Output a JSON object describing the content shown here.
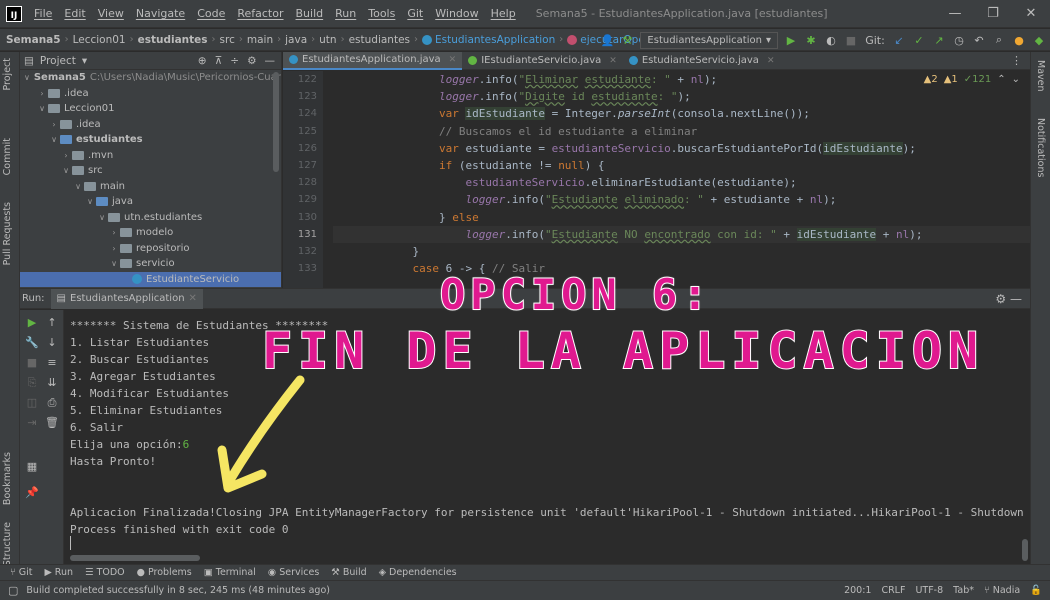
{
  "menubar": {
    "items": [
      "File",
      "Edit",
      "View",
      "Navigate",
      "Code",
      "Refactor",
      "Build",
      "Run",
      "Tools",
      "Git",
      "Window",
      "Help"
    ],
    "window_title": "Semana5 - EstudiantesApplication.java [estudiantes]",
    "minimize": "—",
    "maximize": "❐",
    "close": "✕"
  },
  "breadcrumbs": [
    "Semana5",
    "Leccion01",
    "estudiantes",
    "src",
    "main",
    "java",
    "utn",
    "estudiantes",
    "EstudiantesApplication",
    "ejecutarOpciones"
  ],
  "navbar": {
    "run_config": "EstudiantesApplication",
    "git_label": "Git:"
  },
  "left_stripe": {
    "project": "Project",
    "commit": "Commit",
    "pull_requests": "Pull Requests",
    "bookmarks": "Bookmarks",
    "structure": "Structure"
  },
  "right_stripe": {
    "maven": "Maven",
    "notifications": "Notifications"
  },
  "project_panel": {
    "title": "Project",
    "tree": [
      {
        "label": "Semana5",
        "muted": "C:\\Users\\Nadia\\Music\\Pericornios-Cuarto-Se",
        "depth": 0,
        "open": true,
        "bold": true
      },
      {
        "label": ".idea",
        "depth": 1,
        "open": false
      },
      {
        "label": "Leccion01",
        "depth": 1,
        "open": true
      },
      {
        "label": ".idea",
        "depth": 2,
        "open": false
      },
      {
        "label": "estudiantes",
        "depth": 2,
        "open": true,
        "bold": true
      },
      {
        "label": ".mvn",
        "depth": 3,
        "open": false
      },
      {
        "label": "src",
        "depth": 3,
        "open": true
      },
      {
        "label": "main",
        "depth": 4,
        "open": true
      },
      {
        "label": "java",
        "depth": 5,
        "open": true
      },
      {
        "label": "utn.estudiantes",
        "depth": 6,
        "open": true
      },
      {
        "label": "modelo",
        "depth": 7,
        "open": false
      },
      {
        "label": "repositorio",
        "depth": 7,
        "open": false
      },
      {
        "label": "servicio",
        "depth": 7,
        "open": true
      },
      {
        "label": "EstudianteServicio",
        "depth": 8,
        "selected": true
      }
    ]
  },
  "editor": {
    "tabs": [
      {
        "label": "EstudiantesApplication.java",
        "active": true,
        "color": "#3592c4"
      },
      {
        "label": "IEstudianteServicio.java",
        "active": false,
        "color": "#62b543"
      },
      {
        "label": "EstudianteServicio.java",
        "active": false,
        "color": "#3592c4"
      }
    ],
    "inspections": {
      "warnings": "▲2",
      "weak": "▲1",
      "ok": "✓121"
    },
    "line_numbers": [
      "122",
      "123",
      "124",
      "125",
      "126",
      "127",
      "128",
      "129",
      "130",
      "131",
      "132",
      "133"
    ],
    "current_line": "131"
  },
  "run_panel": {
    "label": "Run:",
    "tab": "EstudiantesApplication",
    "output": [
      "******* Sistema de Estudiantes ********",
      "1. Listar Estudiantes",
      "2. Buscar Estudiantes",
      "3. Agregar Estudiantes",
      "4. Modificar Estudiantes",
      "5. Eliminar Estudiantes",
      "6. Salir",
      "Elija una opción:",
      "Hasta Pronto!",
      "",
      "",
      "Aplicacion Finalizada!Closing JPA EntityManagerFactory for persistence unit 'default'HikariPool-1 - Shutdown initiated...HikariPool-1 - Shutdown completed.",
      "Process finished with exit code 0"
    ],
    "user_input": "6"
  },
  "overlay": {
    "title": "OPCION 6:",
    "subtitle": "FIN DE LA APLICACION",
    "arrow_color": "#f5e663",
    "text_color": "#e0198f"
  },
  "toolbar": {
    "items": [
      "Git",
      "Run",
      "TODO",
      "Problems",
      "Terminal",
      "Services",
      "Build",
      "Dependencies"
    ]
  },
  "statusbar": {
    "message": "Build completed successfully in 8 sec, 245 ms (48 minutes ago)",
    "position": "200:1",
    "line_sep": "CRLF",
    "encoding": "UTF-8",
    "indent": "Tab*",
    "user": "Nadia"
  }
}
